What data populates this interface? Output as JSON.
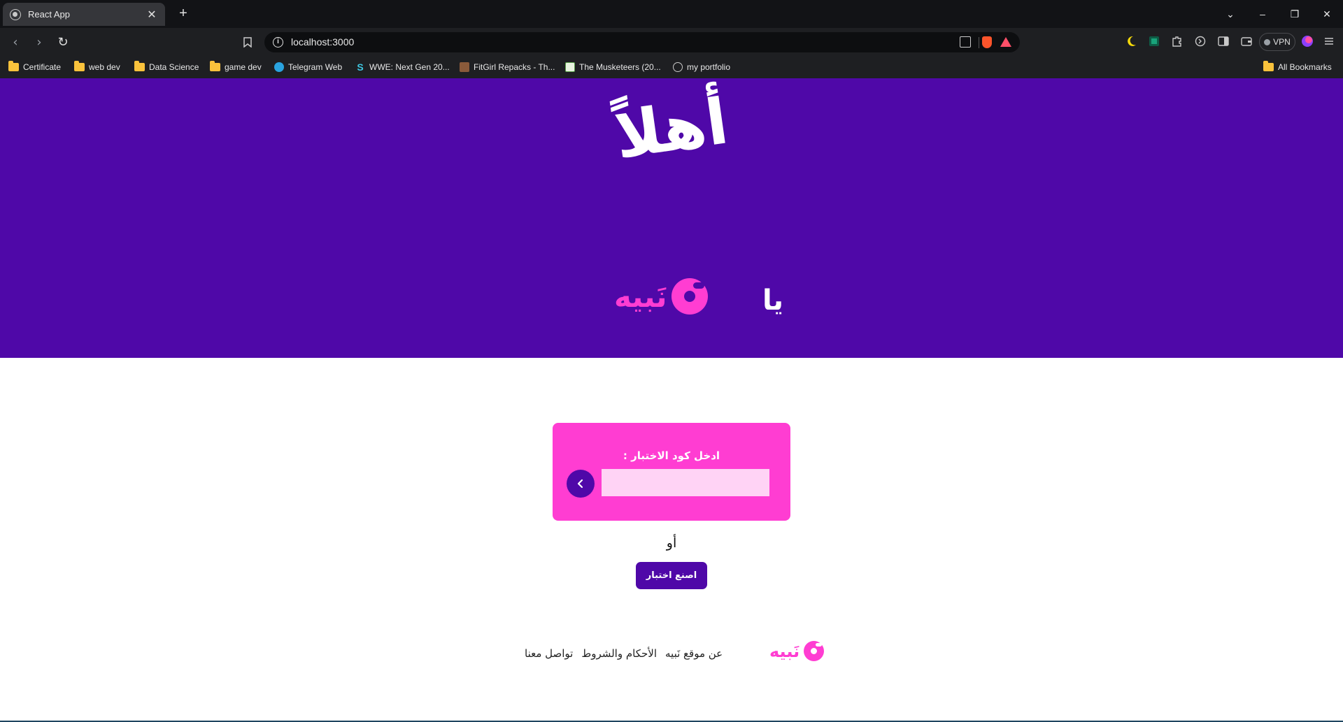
{
  "browser": {
    "tab_title": "React App",
    "url": "localhost:3000",
    "vpn_label": "VPN",
    "bookmarks": [
      {
        "label": "Certificate",
        "icon": "folder-icon"
      },
      {
        "label": "web dev",
        "icon": "folder-icon"
      },
      {
        "label": "Data Science",
        "icon": "folder-icon"
      },
      {
        "label": "game dev",
        "icon": "folder-icon"
      },
      {
        "label": "Telegram Web",
        "icon": "telegram-icon"
      },
      {
        "label": "WWE: Next Gen 20...",
        "icon": "site-icon"
      },
      {
        "label": "FitGirl Repacks - Th...",
        "icon": "site-icon"
      },
      {
        "label": "The Musketeers (20...",
        "icon": "site-icon"
      },
      {
        "label": "my portfolio",
        "icon": "globe-icon"
      }
    ],
    "all_bookmarks_label": "All Bookmarks"
  },
  "hero": {
    "title": "أهلاً",
    "ya": "يا",
    "brand_name": "نَبيه"
  },
  "code_form": {
    "label": "ادخل كود الاختبار :",
    "input_value": "",
    "submit_icon": "chevron-left-icon"
  },
  "or_text": "أو",
  "create_quiz_label": "اصنع اختبار",
  "footer": {
    "brand_name": "نَبيه",
    "links": [
      "عن موقع نَبيه",
      "الأحكام والشروط",
      "تواصل معنا"
    ]
  },
  "colors": {
    "primary_purple": "#4f08a8",
    "brand_pink": "#ff3dd2",
    "input_pink": "#ffd3f5"
  }
}
